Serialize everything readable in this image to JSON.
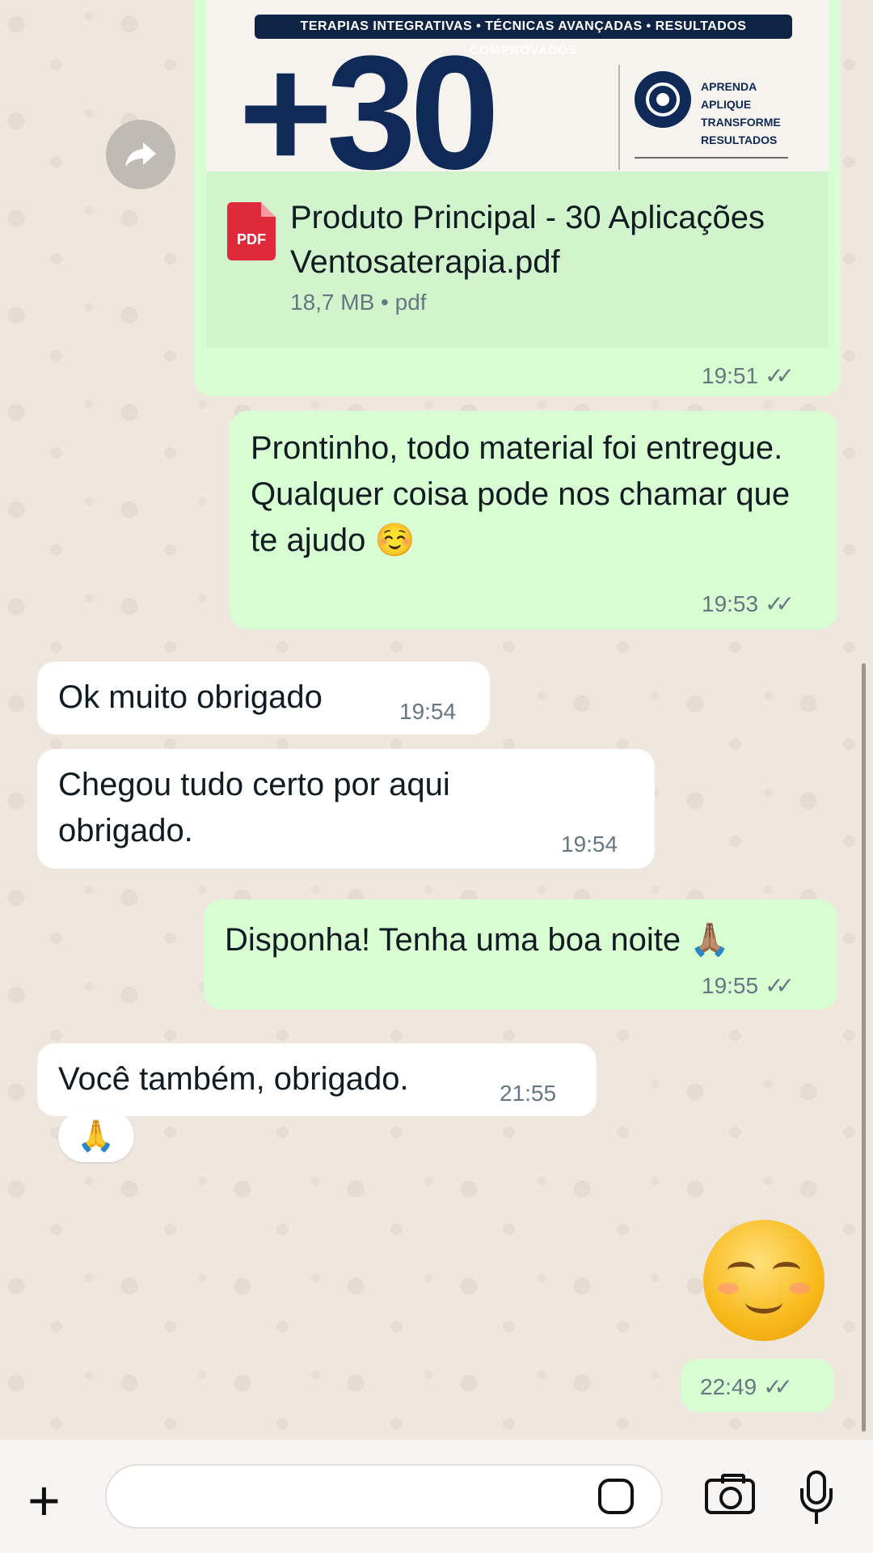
{
  "document_message": {
    "preview_banner": "TERAPIAS INTEGRATIVAS • TÉCNICAS AVANÇADAS • RESULTADOS COMPROVADOS",
    "preview_big": "+30",
    "preview_tagline": [
      "APRENDA",
      "APLIQUE",
      "TRANSFORME",
      "RESULTADOS"
    ],
    "icon_label": "PDF",
    "file_name": "Produto Principal - 30 Aplicações Ventosaterapia.pdf",
    "meta": "18,7 MB • pdf",
    "time": "19:51",
    "ticks": "✓✓"
  },
  "messages": [
    {
      "dir": "out",
      "text": "Prontinho, todo material foi entregue.\nQualquer coisa pode nos chamar que te ajudo ☺️",
      "time": "19:53",
      "ticks": "✓✓"
    },
    {
      "dir": "in",
      "text": "Ok muito obrigado",
      "time": "19:54"
    },
    {
      "dir": "in",
      "text": "Chegou tudo certo por aqui obrigado.",
      "time": "19:54"
    },
    {
      "dir": "out",
      "text": "Disponha! Tenha uma boa noite 🙏🏽",
      "time": "19:55",
      "ticks": "✓✓"
    },
    {
      "dir": "in",
      "text": "Você também, obrigado.",
      "time": "21:55",
      "reaction": "🙏"
    },
    {
      "dir": "out",
      "sticker": "smiling-face",
      "time": "22:49",
      "ticks": "✓✓"
    }
  ],
  "composer": {
    "placeholder": ""
  },
  "icons": [
    "forward-icon",
    "pdf-icon",
    "plus-icon",
    "sticker-icon",
    "camera-icon",
    "mic-icon"
  ]
}
